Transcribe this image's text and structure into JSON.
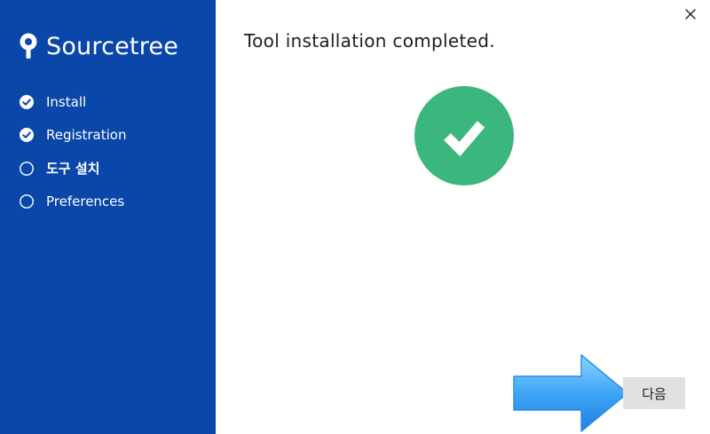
{
  "app": {
    "brand_name": "Sourcetree",
    "brand_icon": "sourcetree-logo-icon"
  },
  "steps": [
    {
      "label": "Install",
      "state": "done",
      "icon": "check-circle-icon"
    },
    {
      "label": "Registration",
      "state": "done",
      "icon": "check-circle-icon"
    },
    {
      "label": "도구 설치",
      "state": "current",
      "icon": "empty-circle-icon"
    },
    {
      "label": "Preferences",
      "state": "pending",
      "icon": "empty-circle-icon"
    }
  ],
  "main": {
    "title": "Tool installation completed.",
    "status_icon": "success-check-icon"
  },
  "buttons": {
    "next_label": "다음",
    "close_icon": "close-icon"
  },
  "colors": {
    "sidebar_bg": "#0a47a9",
    "success_green": "#3bb77e",
    "button_bg": "#e1e1e1",
    "arrow_blue": "#3da6f5"
  }
}
